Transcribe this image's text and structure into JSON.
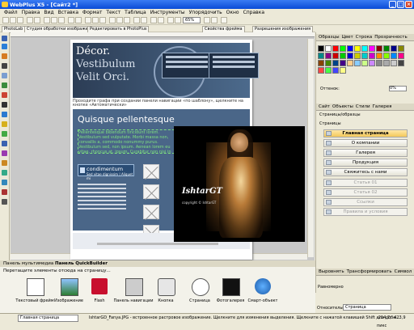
{
  "window": {
    "title": "WebPlus X5 - [Сайт2 *]"
  },
  "menu": [
    "Файл",
    "Правка",
    "Вид",
    "Вставка",
    "Формат",
    "Текст",
    "Таблица",
    "Инструменты",
    "Упорядочить",
    "Окно",
    "Справка"
  ],
  "toolbar": {
    "zoom": "65%"
  },
  "doc_tabs": [
    "PhotoLab",
    "Студия обработки изображений",
    "Редактировать в PhotoPlus",
    "Свойства фрейма",
    "Разрешения изображения"
  ],
  "page": {
    "hero_line1": "Décor.",
    "hero_line2": "Vestibulum",
    "hero_line3": "Velit Orci.",
    "links_hint": "Проходите графа при создании панели навигации «по шаблону», щелкните на кнопке «Автоматически»",
    "heading": "Quisque pellentesque",
    "green_text": "Pellentesque bibendum tincidunt lorem. Vestibulum sed vulputate. Morbi massa non, convallis a, commodo nonummy purus. Vestibulum sed, non ipsum. Aenean lorem eu vitae, rhoncus at, ipsum. Curabitur non nisi in pretium fermentum lorem. Aenean euismod eu, aliquet non, leo.",
    "cond_big": "condimentum",
    "cond_small": "Sed vitae dignissim | Aliquet mi"
  },
  "photo": {
    "signature": "IshtarGT",
    "copyright": "copyright © IshtarGT"
  },
  "right_panel": {
    "tabs1": [
      "Образцы",
      "Цвет",
      "Строка",
      "Прозрачность"
    ],
    "tint_label": "Оттенок:",
    "tint_value": "0%",
    "tabs2": [
      "Сайт",
      "Объекты",
      "Стили",
      "Галерея"
    ],
    "site_header": "Страницы/образцы",
    "site_sub": "Страницы",
    "pages": [
      "Главная страница",
      "О компании",
      "Галерея",
      "Продукция",
      "Свяжитесь с нами",
      "Статья 01",
      "Статья 02",
      "Ссылки",
      "Правила и условия"
    ],
    "tabs3": [
      "Выровнять",
      "Трансформировать",
      "Символ"
    ],
    "rel_label": "Относительно:",
    "rel_value": "Страница",
    "spacing_label": "Равномерно"
  },
  "bottom_panel": {
    "tabs": [
      "Панель мультимедиа",
      "Панель QuickBuilder"
    ],
    "hint": "Перетащите элементы отсюда на страницу...",
    "items": [
      "Текстовый фрейм",
      "Изображение",
      "Flash",
      "Панель навигации",
      "Кнопка",
      "Страница",
      "Фотогалерея",
      "Смарт-объект"
    ]
  },
  "status": {
    "page": "Главная страница",
    "message": "IshtarGD_Fanya.JPG - встроенное растровое изображение. Щелкните для изменения выделения. Щелкните с нажатой клавишей Shift для доба...",
    "coords": "-214,7; -423,9 пикс"
  },
  "colors": {
    "accent": "#0a4bd6",
    "home_page": "#f4c85a",
    "green_text": "#7fe07f"
  }
}
